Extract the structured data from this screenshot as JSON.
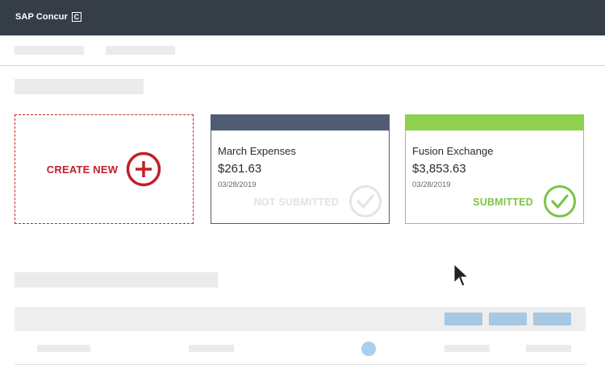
{
  "header": {
    "brand": "SAP Concur",
    "logo_letter": "C"
  },
  "create_card": {
    "label": "CREATE NEW",
    "icon": "plus-circle-icon"
  },
  "reports": [
    {
      "name": "March Expenses",
      "amount": "$261.63",
      "date": "03/28/2019",
      "status": "NOT SUBMITTED",
      "icon": "check-circle-icon"
    },
    {
      "name": "Fusion Exchange",
      "amount": "$3,853.63",
      "date": "03/28/2019",
      "status": "SUBMITTED",
      "icon": "check-circle-icon"
    }
  ],
  "colors": {
    "topbar": "#353d47",
    "create_red": "#c21f2a",
    "not_submitted_header": "#4f5c74",
    "submitted_green": "#8fd04f",
    "action_button_blue": "#a6c8e3"
  }
}
